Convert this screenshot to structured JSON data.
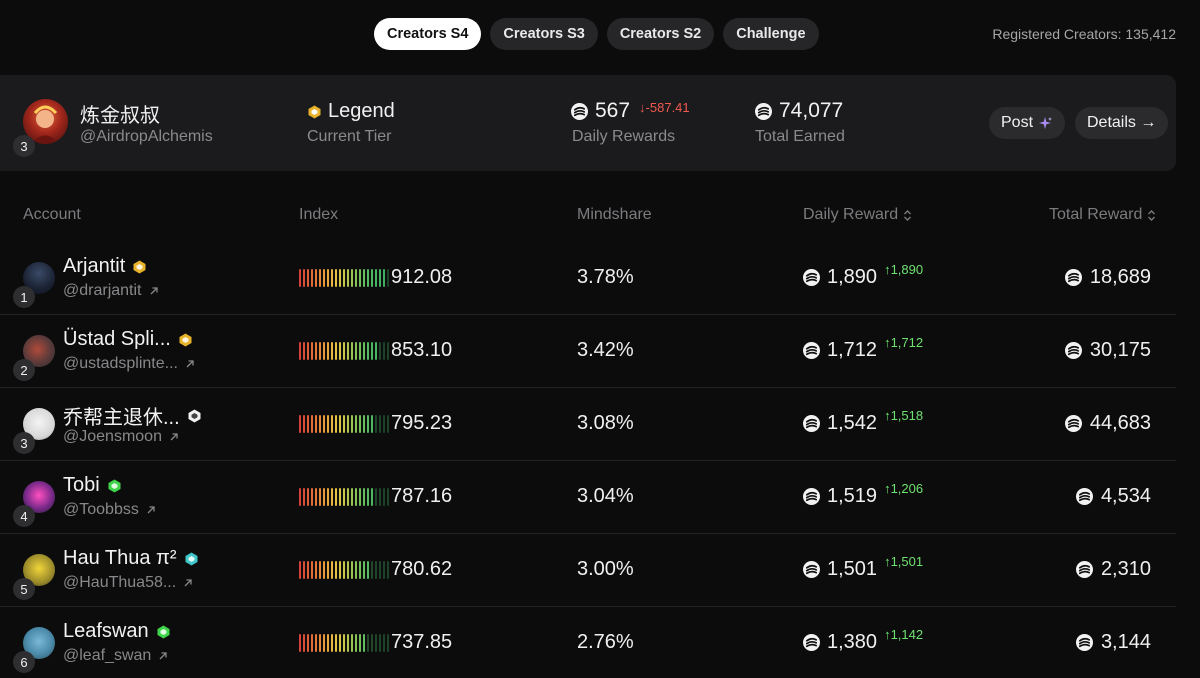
{
  "tabs": [
    {
      "label": "Creators S4",
      "active": true
    },
    {
      "label": "Creators S3",
      "active": false
    },
    {
      "label": "Creators S2",
      "active": false
    },
    {
      "label": "Challenge",
      "active": false
    }
  ],
  "registered": "Registered Creators: 135,412",
  "me": {
    "rank": "3",
    "name": "炼金叔叔",
    "handle": "@AirdropAlchemis",
    "tier": "Legend",
    "tier_label": "Current Tier",
    "daily_value": "567",
    "daily_delta": "↓-587.41",
    "daily_label": "Daily Rewards",
    "total_value": "74,077",
    "total_label": "Total Earned",
    "post_label": "Post",
    "details_label": "Details →"
  },
  "table": {
    "headers": {
      "account": "Account",
      "index": "Index",
      "mindshare": "Mindshare",
      "daily": "Daily Reward",
      "total": "Total Reward"
    },
    "rows": [
      {
        "rank": "1",
        "name": "Arjantit",
        "badge": "gold",
        "handle": "@drarjantit",
        "index": "912.08",
        "index_score": 0.95,
        "mindshare": "3.78%",
        "daily": "1,890",
        "delta": "↑1,890",
        "total": "18,689"
      },
      {
        "rank": "2",
        "name": "Üstad Spli...",
        "badge": "gold",
        "handle": "@ustadsplinte...",
        "index": "853.10",
        "index_score": 0.88,
        "mindshare": "3.42%",
        "daily": "1,712",
        "delta": "↑1,712",
        "total": "30,175"
      },
      {
        "rank": "3",
        "name": "乔帮主退休...",
        "badge": "white",
        "handle": "@Joensmoon",
        "index": "795.23",
        "index_score": 0.82,
        "mindshare": "3.08%",
        "daily": "1,542",
        "delta": "↑1,518",
        "total": "44,683"
      },
      {
        "rank": "4",
        "name": "Tobi",
        "badge": "green",
        "handle": "@Toobbss",
        "index": "787.16",
        "index_score": 0.81,
        "mindshare": "3.04%",
        "daily": "1,519",
        "delta": "↑1,206",
        "total": "4,534"
      },
      {
        "rank": "5",
        "name": "Hau Thua π²",
        "badge": "teal",
        "handle": "@HauThua58...",
        "index": "780.62",
        "index_score": 0.8,
        "mindshare": "3.00%",
        "daily": "1,501",
        "delta": "↑1,501",
        "total": "2,310"
      },
      {
        "rank": "6",
        "name": "Leafswan",
        "badge": "green",
        "handle": "@leaf_swan",
        "index": "737.85",
        "index_score": 0.76,
        "mindshare": "2.76%",
        "daily": "1,380",
        "delta": "↑1,142",
        "total": "3,144"
      }
    ]
  },
  "colors": {
    "gold": "#e8b32a",
    "white": "#f0f0f0",
    "green": "#3fd44a",
    "teal": "#3fc6c9",
    "negative": "#f0594f",
    "positive": "#6ee26e"
  },
  "icons": {
    "token": "token-icon",
    "tier": "hexagon-icon",
    "sparkle": "sparkle-icon",
    "external": "external-link-icon",
    "sort": "sort-icon"
  }
}
